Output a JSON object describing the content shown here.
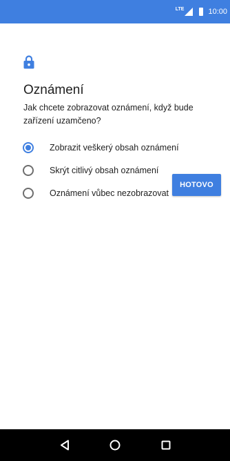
{
  "status_bar": {
    "network": "LTE",
    "time": "10:00",
    "icons": [
      "lte-signal-icon",
      "battery-icon"
    ],
    "color": "#3f7fe0"
  },
  "page": {
    "icon": "lock-icon",
    "title": "Oznámení",
    "subtitle": "Jak chcete zobrazovat oznámení, když bude zařízení uzamčeno?"
  },
  "options": [
    {
      "label": "Zobrazit veškerý obsah oznámení",
      "selected": true
    },
    {
      "label": "Skrýt citlivý obsah oznámení",
      "selected": false
    },
    {
      "label": "Oznámení vůbec nezobrazovat",
      "selected": false
    }
  ],
  "actions": {
    "done_label": "HOTOVO"
  },
  "nav_bar": {
    "icons": [
      "back-icon",
      "home-icon",
      "recents-icon"
    ]
  },
  "colors": {
    "accent": "#3f7fe0",
    "text": "#212121",
    "nav_background": "#000000"
  }
}
